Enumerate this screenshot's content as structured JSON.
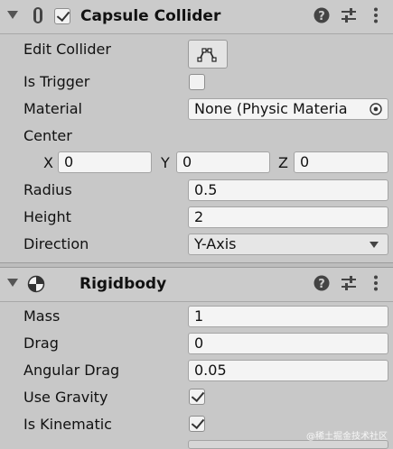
{
  "capsule": {
    "title": "Capsule Collider",
    "enabled": true,
    "edit_collider_label": "Edit Collider",
    "is_trigger_label": "Is Trigger",
    "is_trigger": false,
    "material_label": "Material",
    "material_value": "None (Physic Materia",
    "center_label": "Center",
    "center": {
      "x_label": "X",
      "x": "0",
      "y_label": "Y",
      "y": "0",
      "z_label": "Z",
      "z": "0"
    },
    "radius_label": "Radius",
    "radius": "0.5",
    "height_label": "Height",
    "height": "2",
    "direction_label": "Direction",
    "direction": "Y-Axis"
  },
  "rigidbody": {
    "title": "Rigidbody",
    "mass_label": "Mass",
    "mass": "1",
    "drag_label": "Drag",
    "drag": "0",
    "angular_drag_label": "Angular Drag",
    "angular_drag": "0.05",
    "use_gravity_label": "Use Gravity",
    "use_gravity": true,
    "is_kinematic_label": "Is Kinematic",
    "is_kinematic": true
  },
  "watermark": "@稀土掘金技术社区",
  "icons": [
    "fold-arrow-icon",
    "capsule-icon",
    "help-icon",
    "presets-icon",
    "more-icon",
    "edit-collider-icon",
    "object-picker-icon",
    "dropdown-arrow-icon",
    "rigidbody-icon"
  ]
}
